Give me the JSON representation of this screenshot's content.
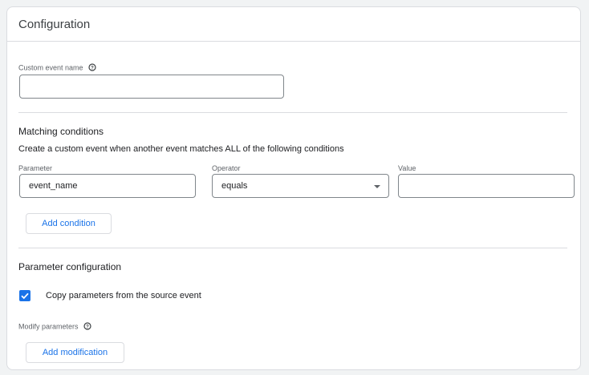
{
  "card": {
    "title": "Configuration"
  },
  "custom_event": {
    "label": "Custom event name",
    "value": ""
  },
  "matching": {
    "title": "Matching conditions",
    "description": "Create a custom event when another event matches ALL of the following conditions",
    "parameter": {
      "label": "Parameter",
      "value": "event_name"
    },
    "operator": {
      "label": "Operator",
      "value": "equals"
    },
    "value": {
      "label": "Value",
      "value": ""
    },
    "add_condition": "Add condition"
  },
  "param_config": {
    "title": "Parameter configuration",
    "copy_label": "Copy parameters from the source event",
    "copy_checked": true,
    "modify_label": "Modify parameters",
    "add_modification": "Add modification"
  },
  "colors": {
    "accent": "#1a73e8",
    "border": "#dadce0"
  },
  "icons": {
    "help": "help-circle-icon",
    "dropdown": "chevron-down-icon",
    "check": "check-icon"
  }
}
